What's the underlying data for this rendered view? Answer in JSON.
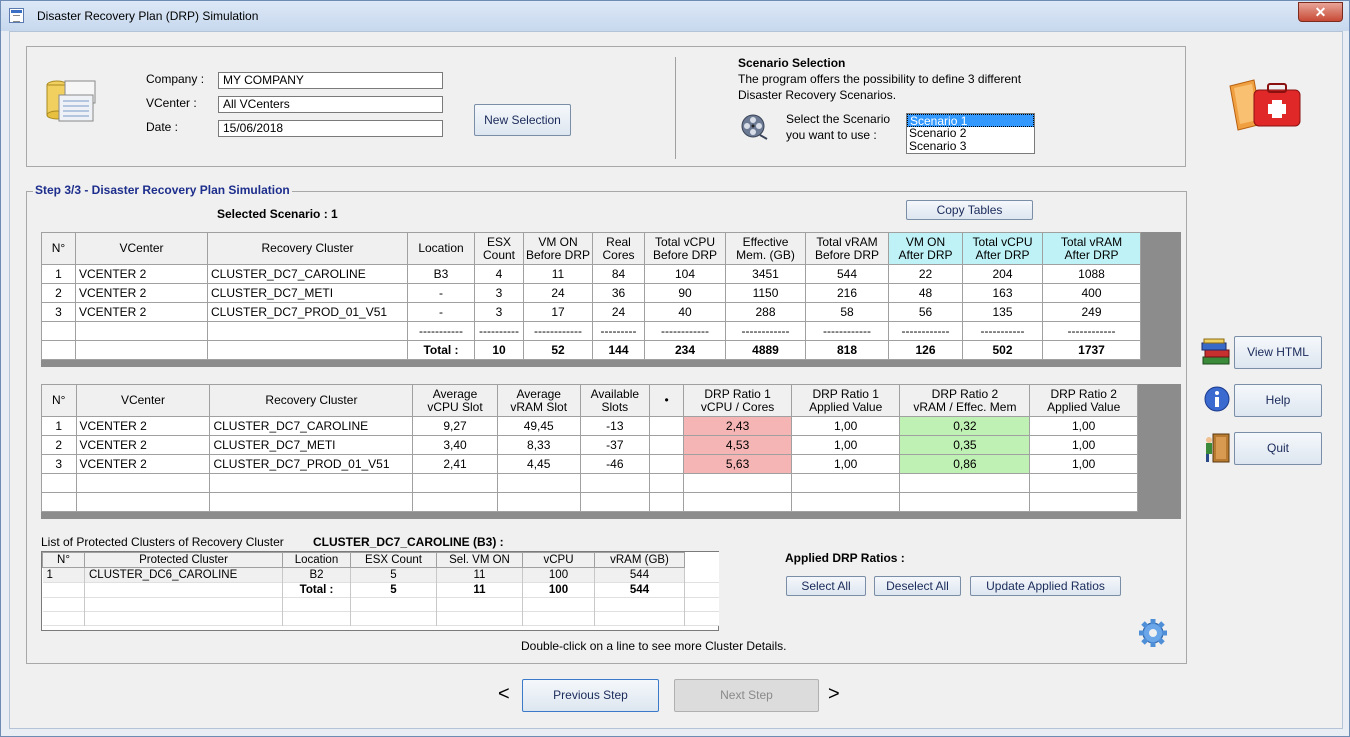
{
  "window": {
    "title": "Disaster Recovery Plan (DRP) Simulation",
    "close": "✕"
  },
  "header": {
    "company_label": "Company :",
    "company_value": "MY COMPANY",
    "vcenter_label": "VCenter :",
    "vcenter_value": "All VCenters",
    "date_label": "Date :",
    "date_value": "15/06/2018",
    "new_selection": "New Selection"
  },
  "scenario": {
    "title": "Scenario Selection",
    "desc1": "The program offers the possibility to define 3 different",
    "desc2": "Disaster Recovery Scenarios.",
    "select1": "Select the Scenario",
    "select2": "you want to use :",
    "options": [
      "Scenario 1",
      "Scenario 2",
      "Scenario 3"
    ]
  },
  "step": {
    "title": "Step 3/3 - Disaster Recovery Plan Simulation",
    "selected": "Selected Scenario : 1",
    "copy_tables": "Copy Tables"
  },
  "table1": {
    "headers": [
      [
        "N°",
        ""
      ],
      [
        "VCenter",
        ""
      ],
      [
        "Recovery Cluster",
        ""
      ],
      [
        "Location",
        ""
      ],
      [
        "ESX",
        "Count"
      ],
      [
        "VM ON",
        "Before DRP"
      ],
      [
        "Real",
        "Cores"
      ],
      [
        "Total vCPU",
        "Before DRP"
      ],
      [
        "Effective",
        "Mem. (GB)"
      ],
      [
        "Total vRAM",
        "Before DRP"
      ],
      [
        "VM ON",
        "After DRP"
      ],
      [
        "Total vCPU",
        "After DRP"
      ],
      [
        "Total vRAM",
        "After DRP"
      ]
    ],
    "rows": [
      [
        "1",
        "VCENTER 2",
        "CLUSTER_DC7_CAROLINE",
        "B3",
        "4",
        "11",
        "84",
        "104",
        "3451",
        "544",
        "22",
        "204",
        "1088"
      ],
      [
        "2",
        "VCENTER 2",
        "CLUSTER_DC7_METI",
        "-",
        "3",
        "24",
        "36",
        "90",
        "1150",
        "216",
        "48",
        "163",
        "400"
      ],
      [
        "3",
        "VCENTER 2",
        "CLUSTER_DC7_PROD_01_V51",
        "-",
        "3",
        "17",
        "24",
        "40",
        "288",
        "58",
        "56",
        "135",
        "249"
      ]
    ],
    "dashes": [
      "",
      "",
      "",
      "-----------",
      "----------",
      "------------",
      "---------",
      "------------",
      "------------",
      "------------",
      "------------",
      "-----------",
      "------------"
    ],
    "total": [
      "",
      "",
      "",
      "Total :",
      "10",
      "52",
      "144",
      "234",
      "4889",
      "818",
      "126",
      "502",
      "1737"
    ]
  },
  "table2": {
    "headers": [
      [
        "N°",
        ""
      ],
      [
        "VCenter",
        ""
      ],
      [
        "Recovery Cluster",
        ""
      ],
      [
        "Average",
        "vCPU Slot"
      ],
      [
        "Average",
        "vRAM Slot"
      ],
      [
        "Available",
        "Slots"
      ],
      [
        "•",
        ""
      ],
      [
        "DRP Ratio 1",
        "vCPU / Cores"
      ],
      [
        "DRP Ratio 1",
        "Applied Value"
      ],
      [
        "DRP Ratio 2",
        "vRAM / Effec. Mem"
      ],
      [
        "DRP Ratio 2",
        "Applied Value"
      ]
    ],
    "rows": [
      [
        "1",
        "VCENTER 2",
        "CLUSTER_DC7_CAROLINE",
        "9,27",
        "49,45",
        "-13",
        "",
        "2,43",
        "1,00",
        "0,32",
        "1,00"
      ],
      [
        "2",
        "VCENTER 2",
        "CLUSTER_DC7_METI",
        "3,40",
        "8,33",
        "-37",
        "",
        "4,53",
        "1,00",
        "0,35",
        "1,00"
      ],
      [
        "3",
        "VCENTER 2",
        "CLUSTER_DC7_PROD_01_V51",
        "2,41",
        "4,45",
        "-46",
        "",
        "5,63",
        "1,00",
        "0,86",
        "1,00"
      ]
    ]
  },
  "protected": {
    "label": "List of Protected Clusters of Recovery Cluster",
    "cluster": "CLUSTER_DC7_CAROLINE (B3) :",
    "headers": [
      "N°",
      "Protected Cluster",
      "Location",
      "ESX Count",
      "Sel. VM ON",
      "vCPU",
      "vRAM (GB)"
    ],
    "row": [
      "1",
      "CLUSTER_DC6_CAROLINE",
      "B2",
      "5",
      "11",
      "100",
      "544"
    ],
    "total": [
      "",
      "",
      "Total :",
      "5",
      "11",
      "100",
      "544"
    ]
  },
  "ratios": {
    "title": "Applied DRP Ratios :",
    "select_all": "Select All",
    "deselect_all": "Deselect All",
    "update": "Update Applied Ratios"
  },
  "hint": "Double-click on a line to see more Cluster Details.",
  "side": {
    "view_html": "View HTML",
    "help": "Help",
    "quit": "Quit"
  },
  "nav": {
    "prev_arrow": "<",
    "prev": "Previous Step",
    "next": "Next Step",
    "next_arrow": ">"
  }
}
